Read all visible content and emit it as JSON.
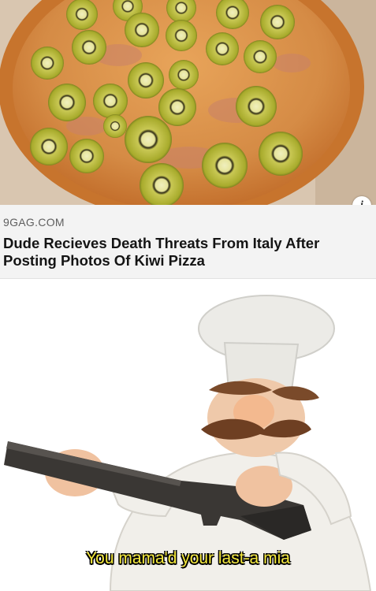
{
  "card": {
    "source": "9GAG.COM",
    "headline": "Dude Recieves Death Threats From Italy After Posting Photos Of Kiwi Pizza",
    "info_icon": "i"
  },
  "meme": {
    "caption": "You mama'd your last-a mia"
  },
  "colors": {
    "caption_text": "#f5e93c",
    "kiwi": "#b6b83a",
    "crust": "#d98a3c"
  }
}
